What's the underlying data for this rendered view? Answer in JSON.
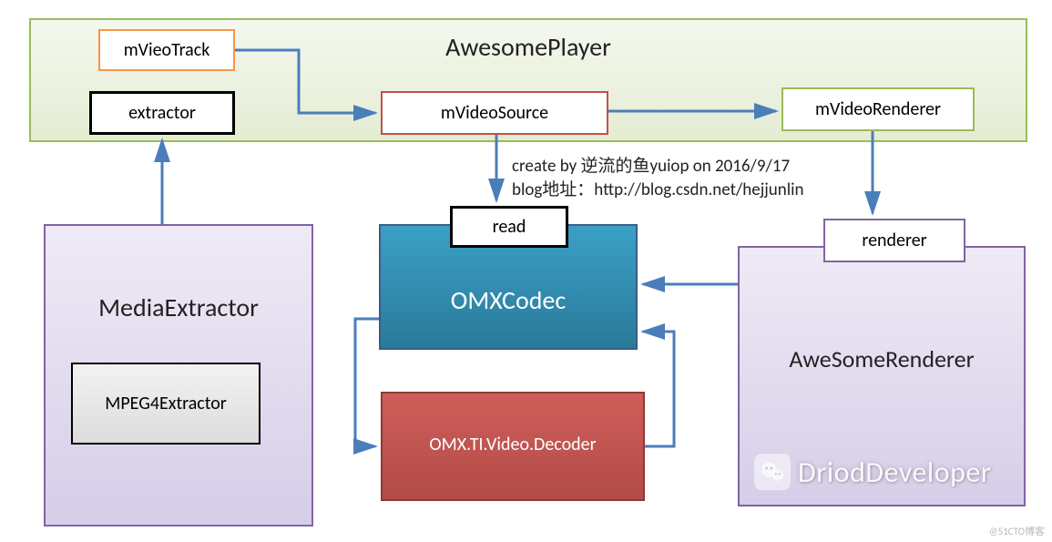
{
  "awesomePlayer": {
    "title": "AwesomePlayer",
    "mVieoTrack": "mVieoTrack",
    "extractor": "extractor",
    "mVideoSource": "mVideoSource",
    "mVideoRenderer": "mVideoRenderer"
  },
  "mediaExtractor": {
    "title": "MediaExtractor",
    "mpeg4": "MPEG4Extractor"
  },
  "omx": {
    "title": "OMXCodec",
    "read": "read",
    "decoder": "OMX.TI.Video.Decoder"
  },
  "awesomeRenderer": {
    "title": "AweSomeRenderer",
    "renderer": "renderer"
  },
  "annotation": {
    "line1": "create by 逆流的鱼yuiop on 2016/9/17",
    "line2": "blog地址：http://blog.csdn.net/hejjunlin"
  },
  "watermark": "DriodDeveloper",
  "credit": "@51CTO博客",
  "colors": {
    "green_fill": "#eaf1dd",
    "green_border": "#9bbb59",
    "orange": "#f79646",
    "black": "#000000",
    "red_border": "#c0504d",
    "red_fill": "#c0504d",
    "purple_border": "#8064a2",
    "panel_purple_fill_top": "#ece8f4",
    "panel_purple_fill_bot": "#d6cee8",
    "blue_fill": "#2f8bb0",
    "arrow": "#4a7ebb"
  }
}
